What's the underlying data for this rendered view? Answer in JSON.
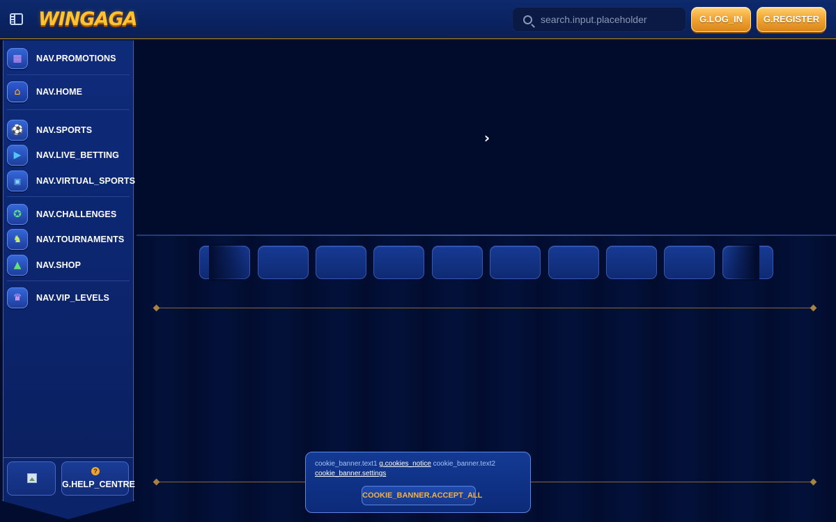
{
  "header": {
    "logo_text": "WINGAGA",
    "search_placeholder": "search.input.placeholder",
    "login_label": "G.LOG_IN",
    "register_label": "G.REGISTER"
  },
  "sidebar": {
    "items": [
      {
        "label": "NAV.PROMOTIONS",
        "icon": "gift-icon"
      },
      {
        "label": "NAV.HOME",
        "icon": "home-icon"
      },
      {
        "label": "NAV.SPORTS",
        "icon": "soccer-ball-icon"
      },
      {
        "label": "NAV.LIVE_BETTING",
        "icon": "play-icon"
      },
      {
        "label": "NAV.VIRTUAL_SPORTS",
        "icon": "ticket-icon"
      },
      {
        "label": "NAV.CHALLENGES",
        "icon": "challenge-badge-icon"
      },
      {
        "label": "NAV.TOURNAMENTS",
        "icon": "trophy-icon"
      },
      {
        "label": "NAV.SHOP",
        "icon": "shopping-bag-icon"
      },
      {
        "label": "NAV.VIP_LEVELS",
        "icon": "crown-icon"
      }
    ],
    "help_label": "G.HELP_CENTRE",
    "help_icon_glyph": "?"
  },
  "cookie_banner": {
    "text1": "cookie_banner.text1",
    "cookies_notice_link": "g.cookies_notice",
    "text2": "cookie_banner.text2",
    "settings_link": "cookie_banner.settings",
    "accept_all_label": "COOKIE_BANNER.ACCEPT_ALL"
  },
  "colors": {
    "accent_gold": "#f2a634",
    "background": "#020c2e",
    "sidebar_blue": "#0e2b7a"
  }
}
